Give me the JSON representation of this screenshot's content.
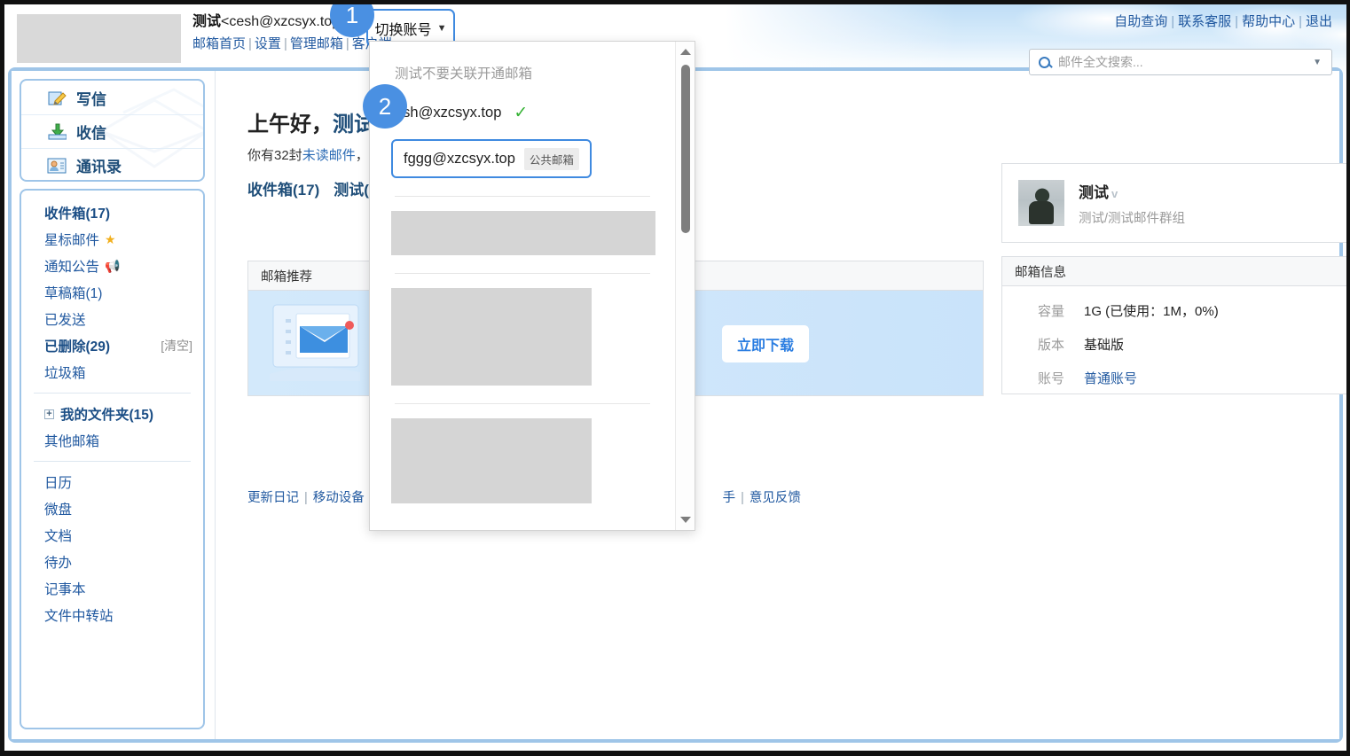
{
  "header": {
    "logo": "company-logo-redacted",
    "account_name": "测试",
    "account_email": "<cesh@xzcsyx.top>",
    "nav_links": [
      "邮箱首页",
      "设置",
      "管理邮箱",
      "客户端"
    ],
    "switch_account_label": "切换账号",
    "top_links": [
      "自助查询",
      "联系客服",
      "帮助中心",
      "退出"
    ],
    "search_placeholder": "邮件全文搜索..."
  },
  "sidebar": {
    "actions": [
      {
        "label": "写信",
        "icon": "compose-icon"
      },
      {
        "label": "收信",
        "icon": "receive-icon"
      },
      {
        "label": "通讯录",
        "icon": "contacts-icon"
      }
    ],
    "folders_group1": [
      {
        "label": "收件箱(17)",
        "bold": true,
        "icon": ""
      },
      {
        "label": "星标邮件",
        "bold": false,
        "icon": "★"
      },
      {
        "label": "通知公告",
        "bold": false,
        "icon": "📢"
      },
      {
        "label": "草稿箱(1)",
        "bold": false,
        "icon": ""
      },
      {
        "label": "已发送",
        "bold": false,
        "icon": ""
      },
      {
        "label": "已删除(29)",
        "bold": true,
        "icon": "",
        "action": "[清空]"
      },
      {
        "label": "垃圾箱",
        "bold": false,
        "icon": ""
      }
    ],
    "folders_group2": [
      {
        "label": "我的文件夹(15)",
        "bold": true,
        "expandable": true
      },
      {
        "label": "其他邮箱",
        "bold": false,
        "expandable": false
      }
    ],
    "folders_group3": [
      {
        "label": "日历"
      },
      {
        "label": "微盘"
      },
      {
        "label": "文档"
      },
      {
        "label": "待办"
      },
      {
        "label": "记事本"
      },
      {
        "label": "文件中转站"
      }
    ]
  },
  "main": {
    "greeting_prefix": "上午好，",
    "greeting_name": "测试。",
    "unread_prefix": "你有32封",
    "unread_link": "未读邮件",
    "unread_suffix": "，1",
    "mailbox_tabs": [
      "收件箱(17)",
      "测试(1"
    ],
    "recommend_title": "邮箱推荐",
    "download_button": "立即下载",
    "footer_links": [
      "更新日记",
      "移动设备",
      "手",
      "意见反馈"
    ]
  },
  "profile": {
    "name": "测试",
    "verified_mark": "v",
    "subtitle": "测试/测试邮件群组"
  },
  "mailbox_info": {
    "title": "邮箱信息",
    "rows": [
      {
        "key": "容量",
        "value": "1G (已使用：1M，0%)",
        "link": false
      },
      {
        "key": "版本",
        "value": "基础版",
        "link": false
      },
      {
        "key": "账号",
        "value": "普通账号",
        "link": true
      }
    ]
  },
  "dropdown": {
    "hint": "测试不要关联开通邮箱",
    "current_account": "esh@xzcsyx.top",
    "current_check": "✓",
    "selected_account": "fggg@xzcsyx.top",
    "selected_tag": "公共邮箱",
    "redacted_items": [
      "redacted-account-1",
      "redacted-account-2",
      "redacted-account-3"
    ]
  },
  "annotations": {
    "badge1": "1",
    "badge2": "2"
  },
  "colors": {
    "accent_blue": "#4a90e2",
    "link_blue": "#2159a0",
    "panel_border": "#9fc5e8",
    "banner_blue": "#cfe6fb",
    "check_green": "#34b233"
  }
}
